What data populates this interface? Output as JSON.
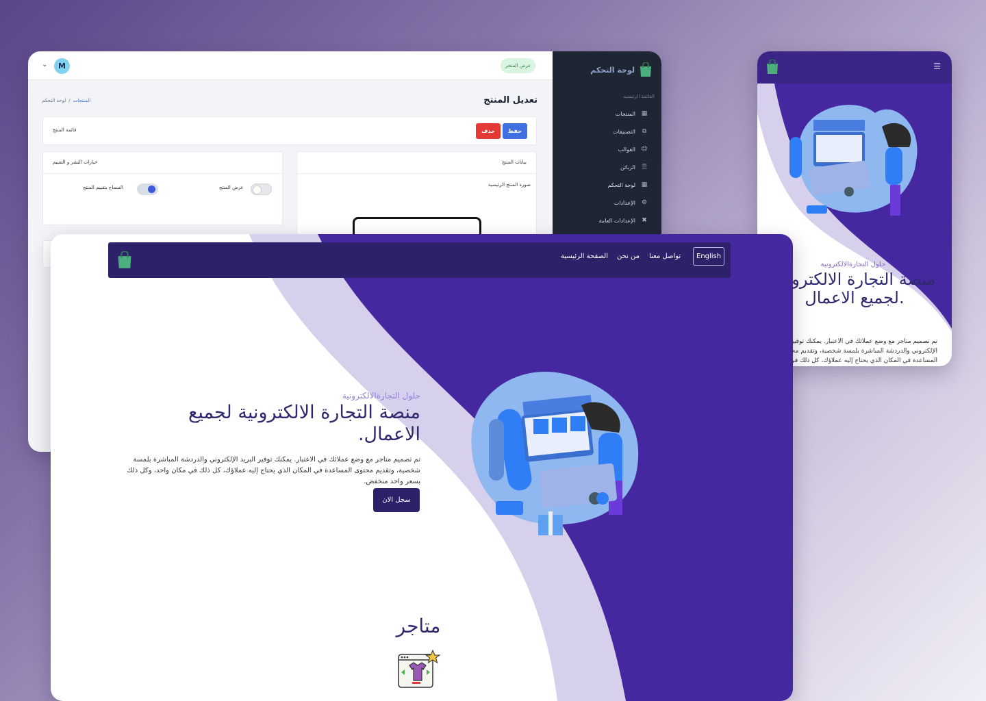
{
  "dashboard": {
    "brand": "لوحة التحكم",
    "user_initial": "M",
    "store_button": "عرض المتجر",
    "section_label": "القائمة الرئيسية",
    "sidebar_items": [
      {
        "label": "المنتجات",
        "icon": "grid-icon"
      },
      {
        "label": "التصنيفات",
        "icon": "tag-icon"
      },
      {
        "label": "القوالب",
        "icon": "user-icon"
      },
      {
        "label": "الزبائن",
        "icon": "list-icon"
      },
      {
        "label": "لوحة التحكم",
        "icon": "table-icon"
      },
      {
        "label": "الإعدادات",
        "icon": "gear-icon"
      },
      {
        "label": "الإعدادات العامة",
        "icon": "tools-icon"
      }
    ],
    "page_title": "تعديل المنتج",
    "breadcrumb": {
      "active": "المنتجات",
      "separator": "/",
      "home": "لوحة التحكم"
    },
    "toolbar": {
      "save": "حفظ",
      "delete": "حذف",
      "list_label": "قائمة المنتج"
    },
    "product_data_title": "بيانات المنتج",
    "main_image_label": "صورة المنتج الرئيسية",
    "publish_panel_title": "خيارات النشر و التقييم",
    "toggle_show": "عرض المنتج",
    "toggle_rating": "السماح بتقييم المنتج",
    "toggle_show_on": false,
    "toggle_rating_on": true,
    "colors": {
      "primary": "#3f6fe0",
      "danger": "#e53935",
      "sidebar": "#1f2633"
    }
  },
  "mobile": {
    "eyebrow": "حلول التجارةالالكترونية",
    "title": "منصة التجارة الالكترونية لجميع الاعمال.",
    "description": "تم تصميم متاجر مع وضع عملائك في الاعتبار. يمكنك توفير البريد الإلكتروني والدردشة المباشرة بلمسة شخصية، وتقديم محتوى المساعدة في المكان الذي يحتاج إليه عملاؤك، كل ذلك في"
  },
  "landing": {
    "nav": {
      "lang": "English",
      "contact": "تواصل معنا",
      "about": "من نحن",
      "home": "الصفحة الرئيسية"
    },
    "eyebrow": "حلول التجارةالالكترونية",
    "title": "منصة التجارة الالكترونية لجميع الاعمال.",
    "description": "تم تصميم متاجر مع وضع عملائك في الاعتبار. يمكنك توفير البريد الإلكتروني والدردشة المباشرة بلمسة شخصية، وتقديم محتوى المساعدة في المكان الذي يحتاج إليه عملاؤك، كل ذلك في مكان واحد، وكل ذلك بسعر واحد منخفض.",
    "cta": "سجل الان",
    "stores_title": "متاجر",
    "colors": {
      "brand_dark": "#2d2169",
      "wave_purple": "#4527a0",
      "wave_light": "#d7d0ec",
      "accent": "#8f7fd4"
    }
  }
}
